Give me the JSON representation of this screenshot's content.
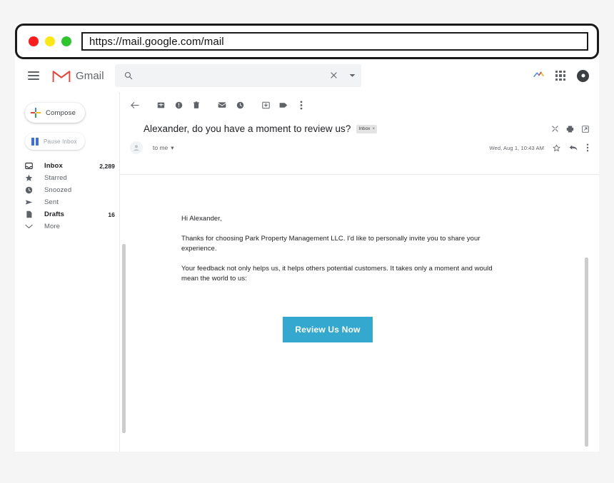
{
  "browser": {
    "url": "https://mail.google.com/mail",
    "dots": [
      "close-red",
      "minimize-yellow",
      "maximize-green"
    ]
  },
  "topbar": {
    "menu_icon": "hamburger-icon",
    "logo_icon": "gmail-logo-icon",
    "brand": "Gmail",
    "search": {
      "placeholder": "",
      "value": "",
      "search_icon": "search-icon",
      "clear_icon": "close-icon",
      "options_icon": "chevron-down-icon"
    },
    "right_icons": [
      "meet-icon",
      "apps-grid-icon",
      "account-avatar-icon"
    ]
  },
  "sidebar": {
    "compose": {
      "label": "Compose",
      "icon": "plus-icon"
    },
    "pause": {
      "label": "Pause Inbox",
      "icon": "pause-icon"
    },
    "items": [
      {
        "label": "Inbox",
        "count": "2,289",
        "icon": "inbox-icon",
        "bold": true
      },
      {
        "label": "Starred",
        "count": "",
        "icon": "star-icon",
        "bold": false
      },
      {
        "label": "Snoozed",
        "count": "",
        "icon": "clock-icon",
        "bold": false
      },
      {
        "label": "Sent",
        "count": "",
        "icon": "send-icon",
        "bold": false
      },
      {
        "label": "Drafts",
        "count": "16",
        "icon": "draft-icon",
        "bold": true
      },
      {
        "label": "More",
        "count": "",
        "icon": "chevron-down-icon",
        "bold": false
      }
    ]
  },
  "toolbar": {
    "icons": [
      "back-arrow-icon",
      "archive-icon",
      "report-spam-icon",
      "delete-icon",
      "mark-unread-icon",
      "snooze-icon",
      "move-to-inbox-icon",
      "label-icon",
      "more-options-icon"
    ]
  },
  "email": {
    "subject": "Alexander, do you have a moment to review us?",
    "label_chip": {
      "text": "Inbox",
      "close": "×"
    },
    "subject_actions": [
      "collapse-all-icon",
      "print-icon",
      "open-in-new-window-icon"
    ],
    "recipient": "to me",
    "recipient_caret": "▾",
    "date": "Wed, Aug 1, 10:43 AM",
    "meta_icons": [
      "star-icon",
      "reply-icon",
      "more-options-icon"
    ],
    "body": {
      "greeting": "Hi Alexander,",
      "paragraph1": "Thanks for choosing Park Property Management LLC. I'd like to personally invite you to share your experience.",
      "paragraph2": "Your feedback not only helps us, it helps others potential customers. It takes only a moment and would mean the world to us:",
      "cta_label": "Review Us Now"
    }
  },
  "colors": {
    "cta": "#35a8d0",
    "gmail_red": "#ea4335",
    "page_bg": "#f5f5f5",
    "pause_blue": "#3f6fd8"
  }
}
